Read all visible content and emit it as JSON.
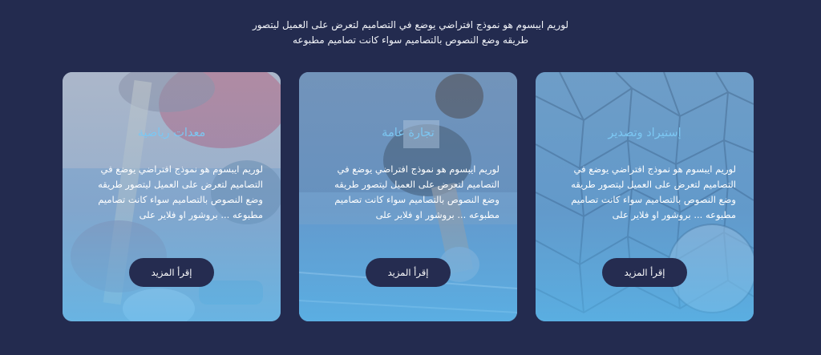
{
  "intro": {
    "line1": "لوريم ايبسوم هو نموذج افتراضي يوضع في التصاميم لتعرض على العميل ليتصور",
    "line2": "طريقه وضع النصوص بالتصاميم سواء كانت تصاميم مطبوعه"
  },
  "colors": {
    "page_background": "#232b4f",
    "card_title": "#7cc7f2",
    "button_background": "#252c50"
  },
  "cards": [
    {
      "title": "إستيراد وتصدير",
      "description": "لوريم ايبسوم هو نموذج افتراضي يوضع في التصاميم لتعرض على العميل ليتصور طريقه وضع النصوص بالتصاميم سواء كانت تصاميم مطبوعه ... بروشور او فلاير على",
      "button_label": "إقرأ المزيد",
      "image": "soccer-ball-net-photo"
    },
    {
      "title": "تجارة عامة",
      "description": "لوريم ايبسوم هو نموذج افتراضي يوضع في التصاميم لتعرض على العميل ليتصور طريقه وضع النصوص بالتصاميم سواء كانت تصاميم مطبوعه ... بروشور او فلاير على",
      "button_label": "إقرأ المزيد",
      "image": "sprinter-start-photo"
    },
    {
      "title": "معدات رياضية",
      "description": "لوريم ايبسوم هو نموذج افتراضي يوضع في التصاميم لتعرض على العميل ليتصور طريقه وضع النصوص بالتصاميم سواء كانت تصاميم مطبوعه ... بروشور او فلاير على",
      "button_label": "إقرأ المزيد",
      "image": "sports-equipment-photo"
    }
  ]
}
